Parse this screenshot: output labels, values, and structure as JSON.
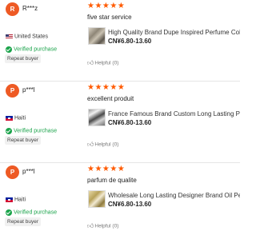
{
  "reviews": [
    {
      "avatar_letter": "R",
      "username": "R***z",
      "country": "United States",
      "flag": "us",
      "verified_label": "Verified purchase",
      "badge": "Repeat buyer",
      "stars": "★★★★★",
      "text": "five star service",
      "product_title": "High Quality Brand Dupe Inspired Perfume Cologne",
      "price": "CN¥6.80-13.60",
      "helpful_label": "Helpful (0)"
    },
    {
      "avatar_letter": "P",
      "username": "p***l",
      "country": "Haiti",
      "flag": "ht",
      "verified_label": "Verified purchase",
      "badge": "Repeat buyer",
      "stars": "★★★★★",
      "text": "excellent produit",
      "product_title": "France Famous Brand Custom Long Lasting Perfume",
      "price": "CN¥6.80-13.60",
      "helpful_label": "Helpful (0)"
    },
    {
      "avatar_letter": "P",
      "username": "p***l",
      "country": "Haiti",
      "flag": "ht",
      "verified_label": "Verified purchase",
      "badge": "Repeat buyer",
      "stars": "★★★★★",
      "text": "parfum de qualite",
      "product_title": "Wholesale Long Lasting Designer Brand Oil Perfume",
      "price": "CN¥6.80-13.60",
      "helpful_label": "Helpful (0)"
    }
  ],
  "colors": {
    "accent": "#ff5a00",
    "avatar": "#ee5a24",
    "verified": "#1aa34a"
  }
}
